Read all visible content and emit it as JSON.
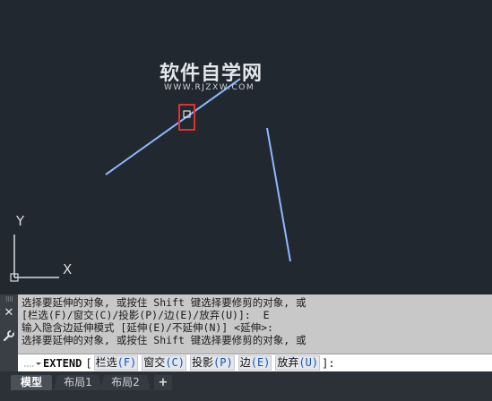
{
  "watermark": {
    "title": "软件自学网",
    "url": "WWW.RJZXW.COM"
  },
  "ucs": {
    "x_label": "X",
    "y_label": "Y"
  },
  "colors": {
    "canvas_bg": "#212830",
    "line": "#8fb8ff",
    "selection_box": "#e03030"
  },
  "command_panel": {
    "close_icon": "close-icon",
    "settings_icon": "wrench-icon",
    "history": [
      "选择要延伸的对象, 或按住 Shift 键选择要修剪的对象, 或",
      "[栏选(F)/窗交(C)/投影(P)/边(E)/放弃(U)]:  E",
      "输入隐含边延伸模式 [延伸(E)/不延伸(N)] <延伸>:",
      "选择要延伸的对象, 或按住 Shift 键选择要修剪的对象, 或"
    ],
    "input": {
      "command": "EXTEND",
      "open_bracket": "[",
      "close_bracket": "]:",
      "options": [
        {
          "label": "栏选",
          "key": "(F)"
        },
        {
          "label": "窗交",
          "key": "(C)"
        },
        {
          "label": "投影",
          "key": "(P)"
        },
        {
          "label": "边",
          "key": "(E)"
        },
        {
          "label": "放弃",
          "key": "(U)"
        }
      ]
    }
  },
  "tabs": [
    {
      "label": "模型",
      "active": true
    },
    {
      "label": "布局1",
      "active": false
    },
    {
      "label": "布局2",
      "active": false
    },
    {
      "label": "+",
      "active": false
    }
  ]
}
